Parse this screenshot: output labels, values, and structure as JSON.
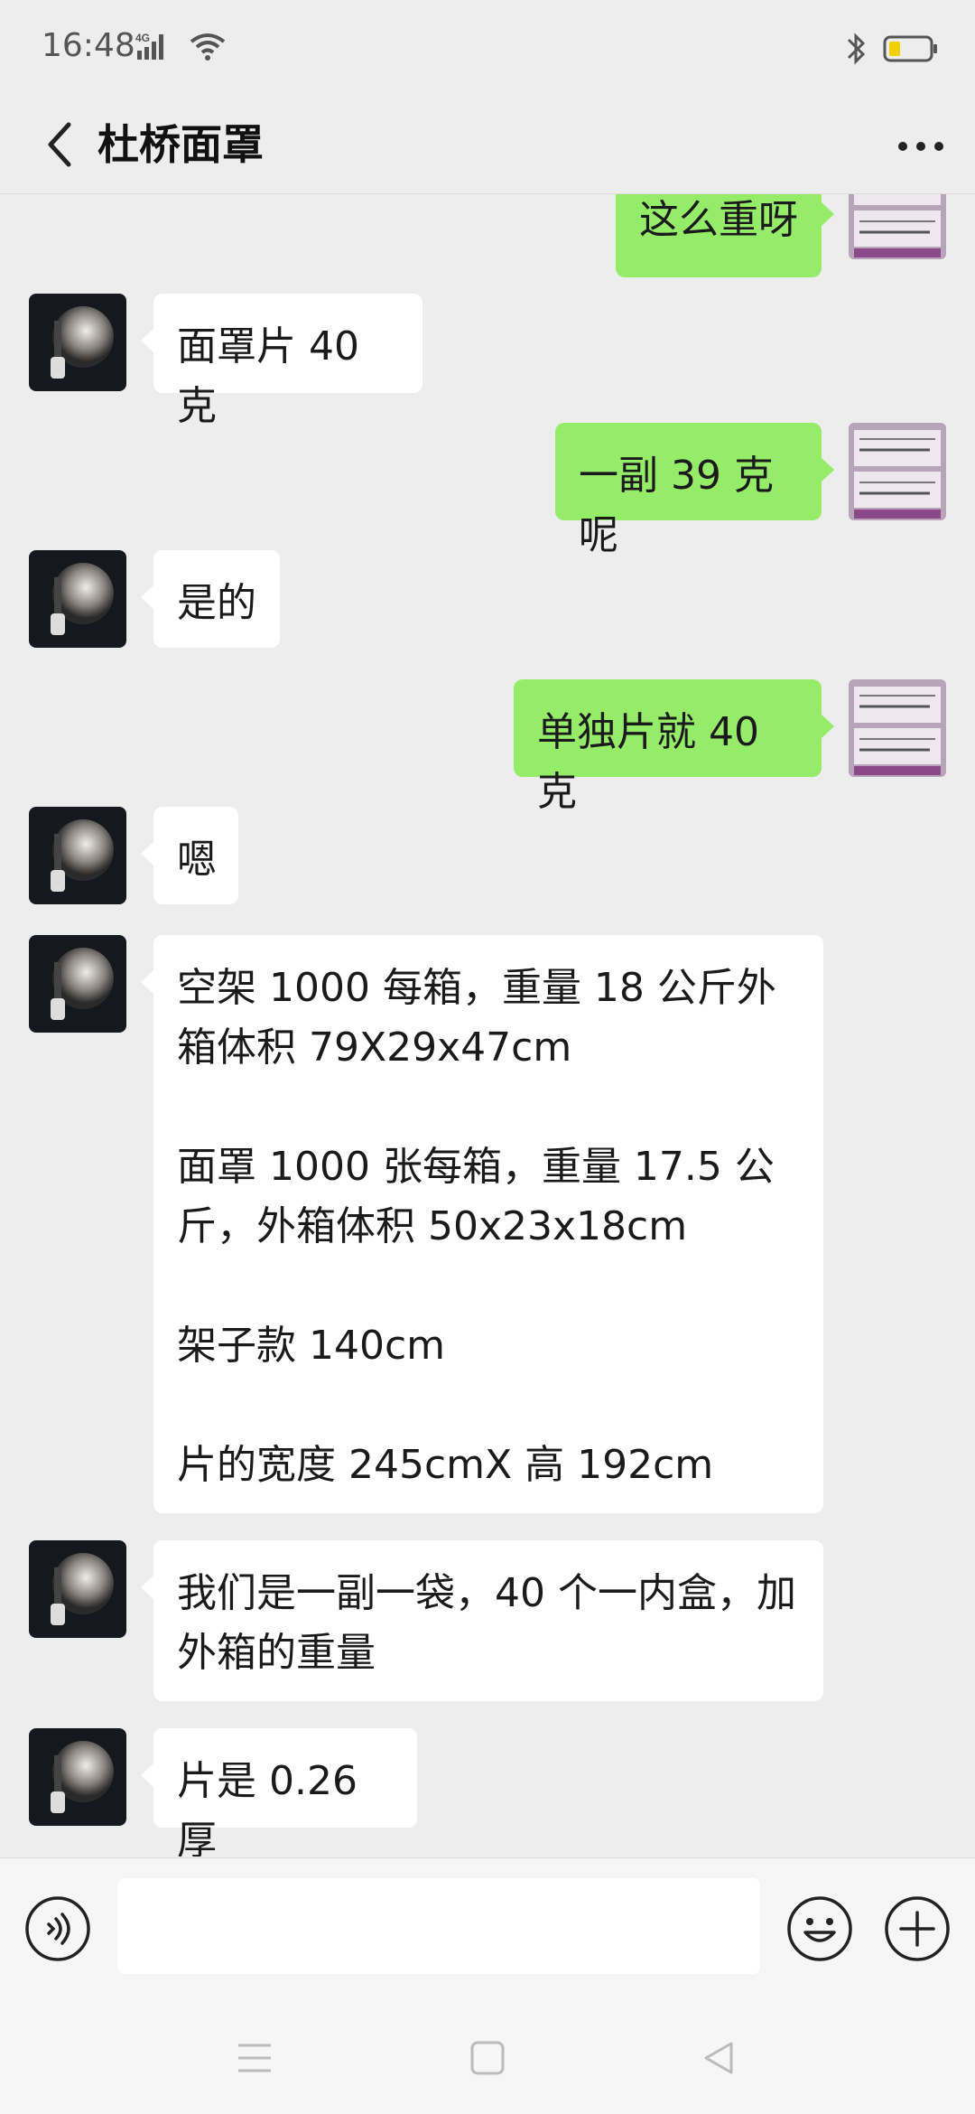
{
  "status": {
    "time": "16:48",
    "network": "4G"
  },
  "header": {
    "title": "杜桥面罩"
  },
  "icons": {
    "back": "chevron-left-icon",
    "more": "more-dots-icon",
    "voice": "voice-icon",
    "emoji": "emoji-icon",
    "plus": "plus-icon"
  },
  "colors": {
    "outgoing_bubble": "#95ec69",
    "incoming_bubble": "#ffffff",
    "background": "#ededed"
  },
  "messages": [
    {
      "side": "out",
      "text": "这么重呀"
    },
    {
      "side": "in",
      "text": "面罩片 40 克"
    },
    {
      "side": "out",
      "text": "一副 39 克呢"
    },
    {
      "side": "in",
      "text": "是的"
    },
    {
      "side": "out",
      "text": "单独片就 40 克"
    },
    {
      "side": "in",
      "text": "嗯"
    },
    {
      "side": "in",
      "text": "空架 1000 每箱，重量 18 公斤外箱体积 79X29x47cm\n\n面罩 1000 张每箱，重量 17.5 公斤，外箱体积 50x23x18cm\n\n架子款 140cm\n\n片的宽度 245cmX 高 192cm"
    },
    {
      "side": "in",
      "text": "我们是一副一袋，40 个一内盒，加外箱的重量"
    },
    {
      "side": "in",
      "text": "片是 0.26 厚"
    }
  ],
  "input": {
    "value": "",
    "placeholder": ""
  }
}
